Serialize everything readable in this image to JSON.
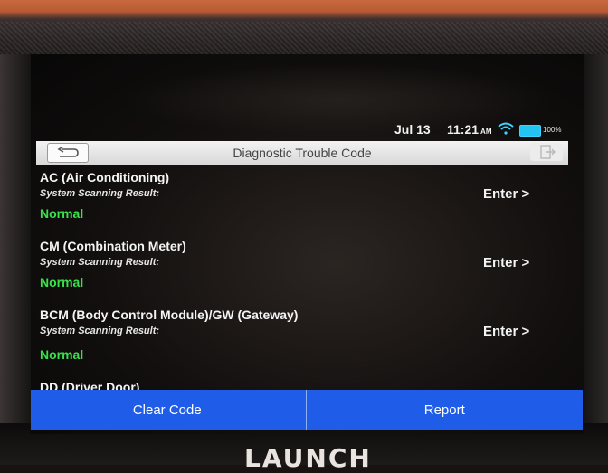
{
  "status_bar": {
    "date": "Jul 13",
    "time": "11:21",
    "ampm": "AM",
    "battery": "100%",
    "wifi_icon": "wifi-icon",
    "battery_icon": "battery-icon"
  },
  "header": {
    "title": "Diagnostic Trouble Code",
    "back_icon": "back-arrow-icon",
    "exit_icon": "exit-icon"
  },
  "systems": [
    {
      "name": "AC (Air Conditioning)",
      "scan_label": "System Scanning Result:",
      "status": "Normal",
      "enter": "Enter >"
    },
    {
      "name": "CM (Combination Meter)",
      "scan_label": "System Scanning Result:",
      "status": "Normal",
      "enter": "Enter >"
    },
    {
      "name": "BCM (Body Control Module)/GW (Gateway)",
      "scan_label": "System Scanning Result:",
      "status": "Normal",
      "enter": "Enter >"
    },
    {
      "name": "DD (Driver Door)"
    }
  ],
  "footer": {
    "clear_code": "Clear Code",
    "report": "Report"
  },
  "device": {
    "brand": "LAUNCH"
  },
  "colors": {
    "accent_blue": "#1f5de8",
    "status_green": "#39e24a"
  }
}
